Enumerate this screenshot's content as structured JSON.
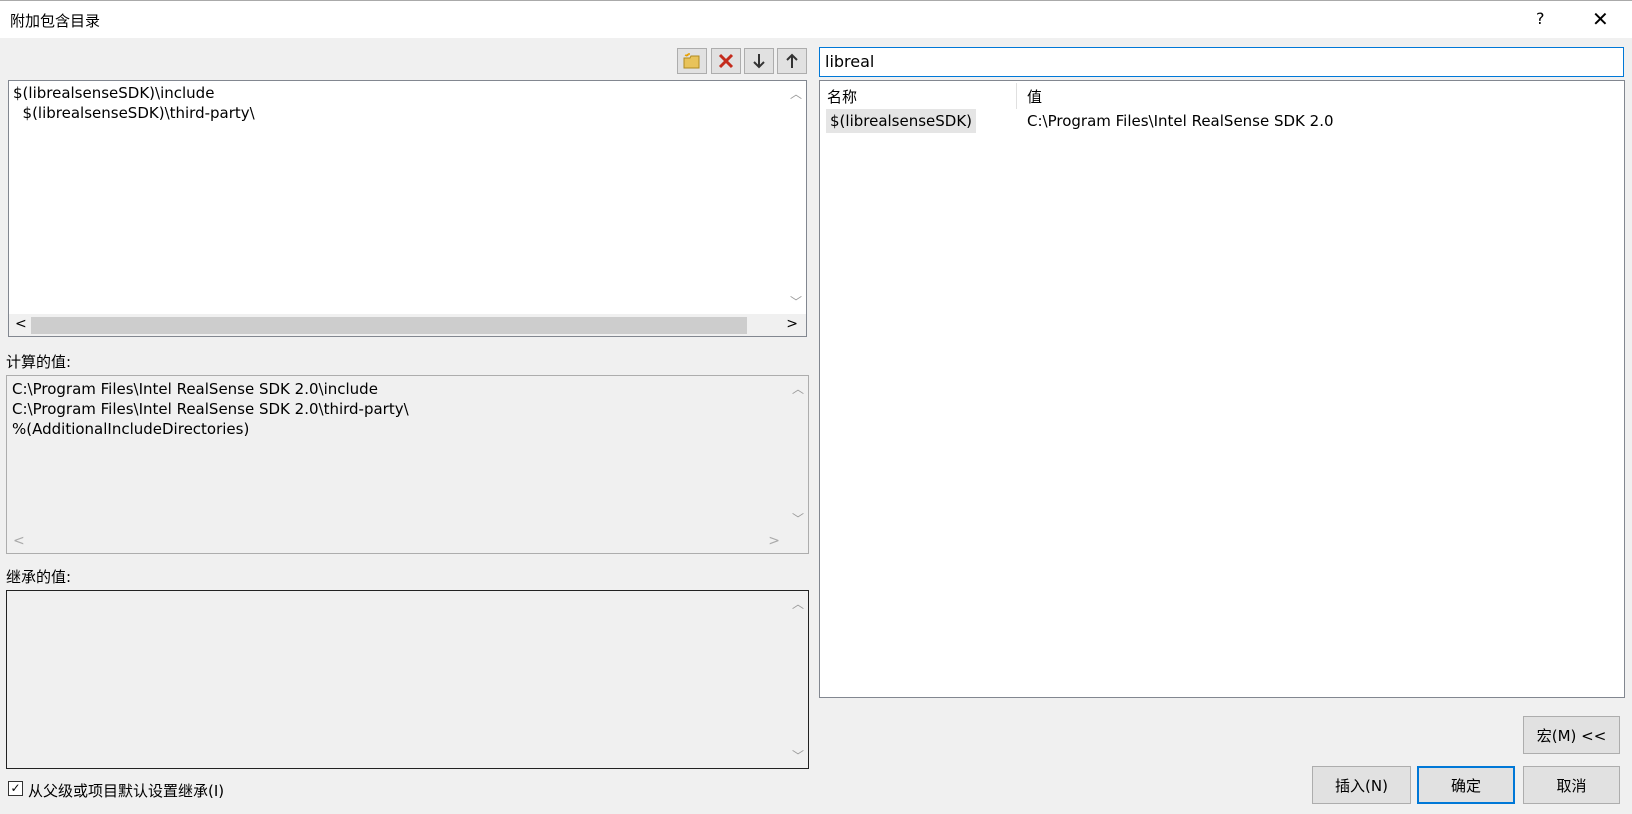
{
  "window": {
    "title": "附加包含目录",
    "help": "?",
    "close": "✕"
  },
  "toolbar": {
    "new_icon": "new-folder-icon",
    "delete_icon": "delete-icon",
    "down_icon": "move-down-icon",
    "up_icon": "move-up-icon",
    "delete_color": "#c42b1c"
  },
  "editor": {
    "lines": [
      "$(librealsenseSDK)\\include",
      "  $(librealsenseSDK)\\third-party\\"
    ]
  },
  "computed": {
    "label": "计算的值:",
    "lines": [
      "C:\\Program Files\\Intel RealSense SDK 2.0\\include",
      "C:\\Program Files\\Intel RealSense SDK 2.0\\third-party\\",
      "%(AdditionalIncludeDirectories)"
    ]
  },
  "inherited": {
    "label": "继承的值:"
  },
  "inherit_checkbox": {
    "label": "从父级或项目默认设置继承(I)",
    "checked": true
  },
  "search": {
    "value": "libreal"
  },
  "macros": {
    "col_name": "名称",
    "col_value": "值",
    "rows": [
      {
        "name": "$(librealsenseSDK)",
        "value": "C:\\Program Files\\Intel RealSense SDK 2.0"
      }
    ]
  },
  "buttons": {
    "macro": "宏(M) <<",
    "insert": "插入(N)",
    "ok": "确定",
    "cancel": "取消"
  }
}
